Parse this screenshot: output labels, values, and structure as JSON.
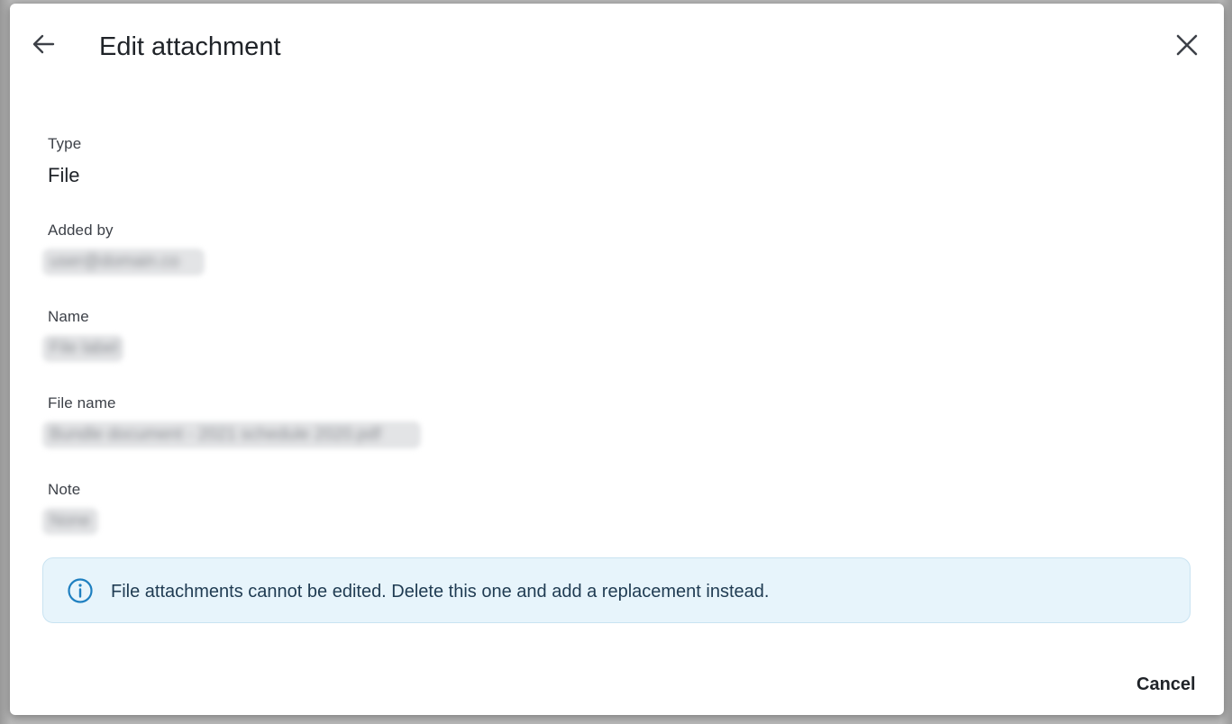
{
  "dialog": {
    "title": "Edit attachment",
    "back_icon": "arrow-left-icon",
    "close_icon": "close-icon"
  },
  "fields": {
    "type": {
      "label": "Type",
      "value": "File"
    },
    "added_by": {
      "label": "Added by",
      "value": "user@domain.co"
    },
    "name": {
      "label": "Name",
      "value": "File label"
    },
    "file_name": {
      "label": "File name",
      "value": "Bundle document - 2021 schedule 2020.pdf"
    },
    "note": {
      "label": "Note",
      "value": "None"
    }
  },
  "info": {
    "icon": "info-icon",
    "message": "File attachments cannot be edited. Delete this one and add a replacement instead.",
    "accent": "#1e7fc0"
  },
  "footer": {
    "cancel_label": "Cancel"
  }
}
